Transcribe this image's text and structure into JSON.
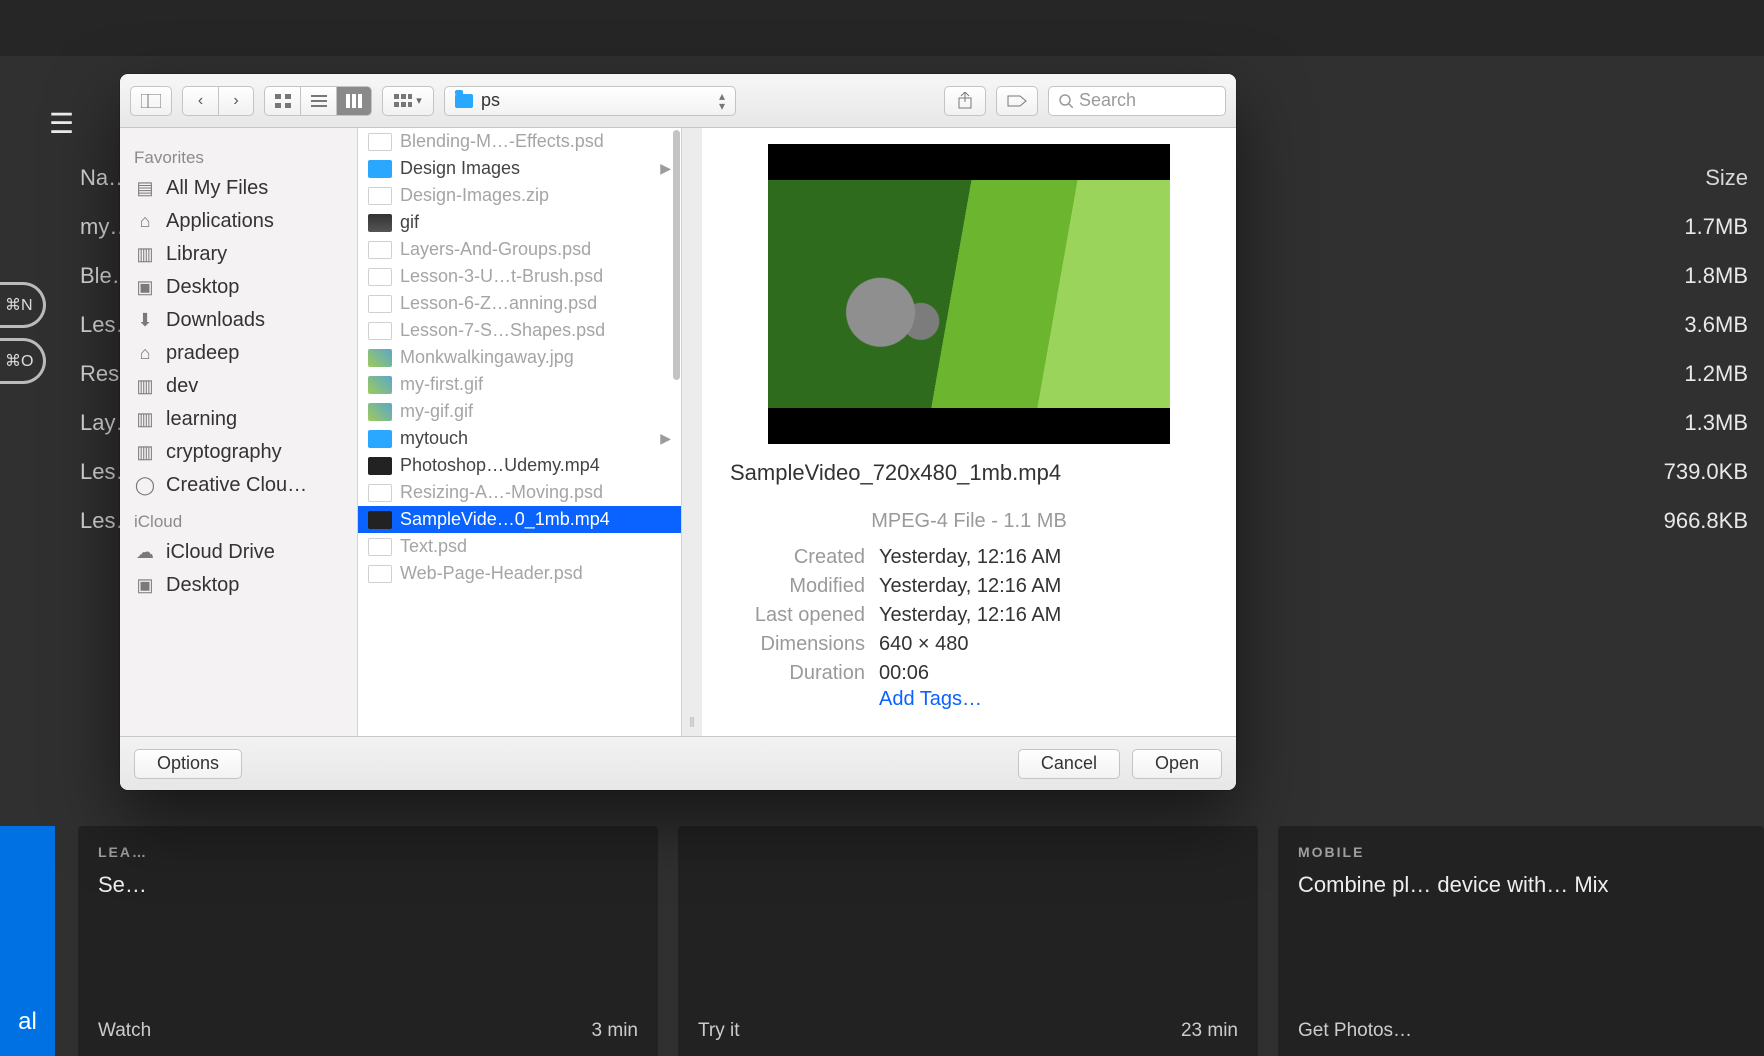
{
  "background": {
    "columns": {
      "name": "Na…",
      "size": "Size"
    },
    "rows": [
      {
        "name": "my…",
        "size": "1.7MB"
      },
      {
        "name": "Ble…",
        "size": "1.8MB"
      },
      {
        "name": "Les…",
        "size": "3.6MB"
      },
      {
        "name": "Res…",
        "size": "1.2MB"
      },
      {
        "name": "Lay…",
        "size": "1.3MB"
      },
      {
        "name": "Les…",
        "size": "739.0KB"
      },
      {
        "name": "Les…",
        "size": "966.8KB"
      }
    ],
    "pills": [
      "⌘N",
      "⌘O"
    ],
    "bluebar": "al",
    "tiles": [
      {
        "label": "LEA…",
        "title": "Se…",
        "footL": "Watch",
        "footR": "3 min"
      },
      {
        "label": "",
        "title": "",
        "footL": "Try it",
        "footR": "23 min"
      },
      {
        "label": "MOBILE",
        "title": "Combine pl… device with… Mix",
        "footL": "Get Photos…",
        "footR": ""
      }
    ]
  },
  "dialog": {
    "path": "ps",
    "search_placeholder": "Search",
    "sidebar": {
      "section1": "Favorites",
      "items1": [
        "All My Files",
        "Applications",
        "Library",
        "Desktop",
        "Downloads",
        "pradeep",
        "dev",
        "learning",
        "cryptography",
        "Creative Clou…"
      ],
      "section2": "iCloud",
      "items2": [
        "iCloud Drive",
        "Desktop"
      ]
    },
    "files": [
      {
        "n": "Blending-M…-Effects.psd",
        "t": "psd",
        "dim": true
      },
      {
        "n": "Design Images",
        "t": "fold",
        "arrow": true
      },
      {
        "n": "Design-Images.zip",
        "t": "zip",
        "dim": true
      },
      {
        "n": "gif",
        "t": "gif"
      },
      {
        "n": "Layers-And-Groups.psd",
        "t": "psd",
        "dim": true
      },
      {
        "n": "Lesson-3-U…t-Brush.psd",
        "t": "psd",
        "dim": true
      },
      {
        "n": "Lesson-6-Z…anning.psd",
        "t": "psd",
        "dim": true
      },
      {
        "n": "Lesson-7-S…Shapes.psd",
        "t": "psd",
        "dim": true
      },
      {
        "n": "Monkwalkingaway.jpg",
        "t": "img",
        "dim": true
      },
      {
        "n": "my-first.gif",
        "t": "img",
        "dim": true
      },
      {
        "n": "my-gif.gif",
        "t": "img",
        "dim": true
      },
      {
        "n": "mytouch",
        "t": "fold",
        "arrow": true
      },
      {
        "n": "Photoshop…Udemy.mp4",
        "t": "mp4"
      },
      {
        "n": "Resizing-A…-Moving.psd",
        "t": "psd",
        "dim": true
      },
      {
        "n": "SampleVide…0_1mb.mp4",
        "t": "mp4",
        "sel": true
      },
      {
        "n": "Text.psd",
        "t": "psd",
        "dim": true
      },
      {
        "n": "Web-Page-Header.psd",
        "t": "psd",
        "dim": true
      }
    ],
    "preview": {
      "filename": "SampleVideo_720x480_1mb.mp4",
      "summary": "MPEG-4 File - 1.1 MB",
      "meta": [
        {
          "k": "Created",
          "v": "Yesterday, 12:16 AM"
        },
        {
          "k": "Modified",
          "v": "Yesterday, 12:16 AM"
        },
        {
          "k": "Last opened",
          "v": "Yesterday, 12:16 AM"
        },
        {
          "k": "Dimensions",
          "v": "640 × 480"
        },
        {
          "k": "Duration",
          "v": "00:06"
        }
      ],
      "addtags": "Add Tags…"
    },
    "footer": {
      "options": "Options",
      "cancel": "Cancel",
      "open": "Open"
    }
  }
}
